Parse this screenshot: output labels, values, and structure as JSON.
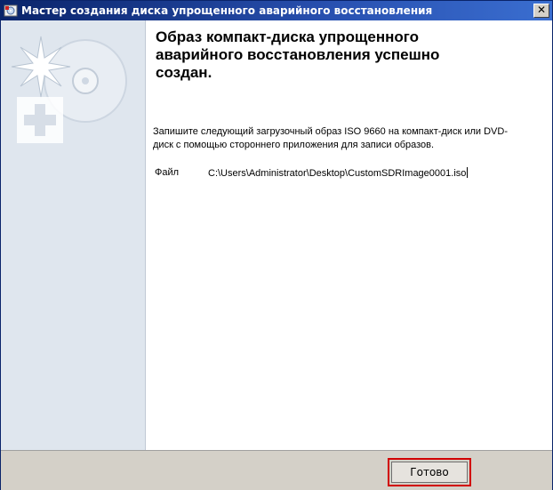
{
  "window": {
    "title": "Мастер создания диска упрощенного аварийного восстановления",
    "close_glyph": "✕",
    "app_icon": "cd-tool-icon"
  },
  "sidebar": {
    "art": [
      "sparkle-icon",
      "cd-disc-icon",
      "medical-cross-icon"
    ]
  },
  "content": {
    "heading": "Образ компакт-диска упрощенного аварийного восстановления успешно создан.",
    "description": "Запишите следующий загрузочный образ ISO 9660 на компакт-диск или DVD-диск с помощью стороннего приложения для записи образов.",
    "file_label": "Файл",
    "file_path": "C:\\Users\\Administrator\\Desktop\\CustomSDRImage0001.iso"
  },
  "footer": {
    "finish_label": "Готово"
  },
  "colors": {
    "titlebar": "#0a246a",
    "sidebar": "#dfe6ee",
    "highlight": "#d10000"
  }
}
